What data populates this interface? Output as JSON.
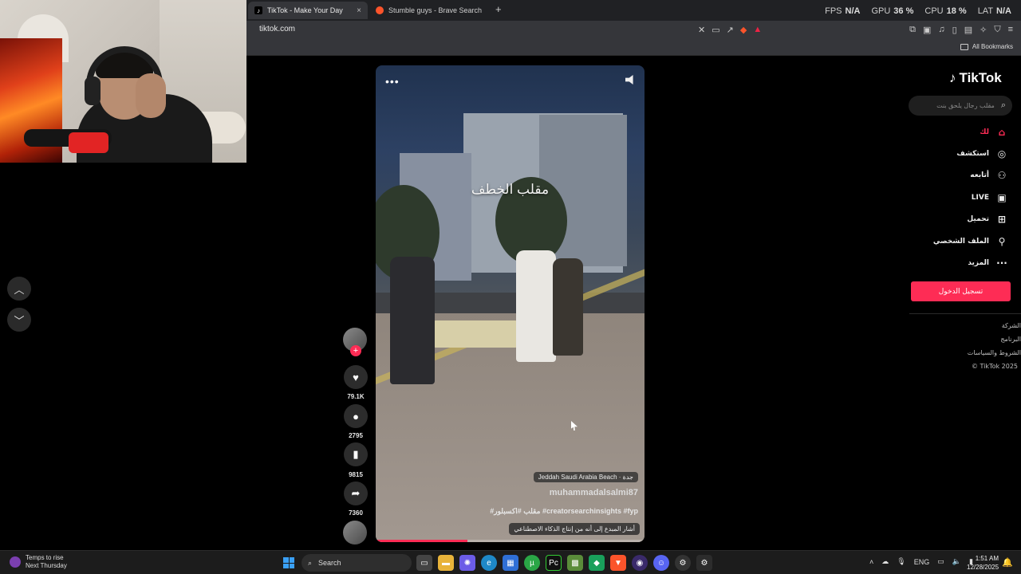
{
  "browser": {
    "tabs": [
      {
        "label": "TikTok - Make Your Day",
        "active": true,
        "favicon": "tiktok-icon"
      },
      {
        "label": "Stumble guys - Brave Search",
        "active": false,
        "favicon": "brave-icon"
      }
    ],
    "new_tab_label": "+",
    "tab_close_glyph": "×",
    "address": "tiktok.com",
    "bookmarks_label": "All Bookmarks"
  },
  "perf_overlay": {
    "fps_label": "FPS",
    "fps_value": "N/A",
    "gpu_label": "GPU",
    "gpu_value": "36 %",
    "cpu_label": "CPU",
    "cpu_value": "18 %",
    "lat_label": "LAT",
    "lat_value": "N/A"
  },
  "video": {
    "overlay_title": "مقلب الخطف",
    "location_badge": "Jeddah Saudi Arabia Beach · جدة",
    "author": "muhammadalsalmi87",
    "hashtags": "#مقلب #اكسبلور #creatorsearchinsights #fyp",
    "caption": "أشار المبدع إلى أنه من إنتاج الذكاء الاصطناعي",
    "progress": 0.34
  },
  "actions": {
    "likes": "79.1K",
    "comments": "2795",
    "saves": "9815",
    "shares": "7360"
  },
  "sidebar": {
    "logo_text": "TikTok",
    "search_placeholder": "مقلب رجال يلحق بنت",
    "nav": [
      {
        "label": "لك",
        "icon": "home-icon",
        "active": true
      },
      {
        "label": "استكشف",
        "icon": "compass-icon",
        "active": false
      },
      {
        "label": "أتابعه",
        "icon": "user-plus-icon",
        "active": false
      },
      {
        "label": "LIVE",
        "icon": "live-tv-icon",
        "active": false
      },
      {
        "label": "تحميل",
        "icon": "upload-icon",
        "active": false
      },
      {
        "label": "الملف الشخصي",
        "icon": "profile-icon",
        "active": false
      },
      {
        "label": "المزيد",
        "icon": "more-icon",
        "active": false
      }
    ],
    "login_label": "تسجيل الدخول",
    "footer": [
      "الشركة",
      "البرنامج",
      "الشروط والسياسات",
      "© TikTok 2025"
    ]
  },
  "taskbar": {
    "weather_line1": "Temps to rise",
    "weather_line2": "Next Thursday",
    "search_label": "Search",
    "lang": "ENG",
    "time": "1:51 AM",
    "date": "12/28/2025"
  },
  "colors": {
    "accent": "#fe2c55",
    "chrome_bg": "#35363a",
    "page_bg": "#000000"
  }
}
